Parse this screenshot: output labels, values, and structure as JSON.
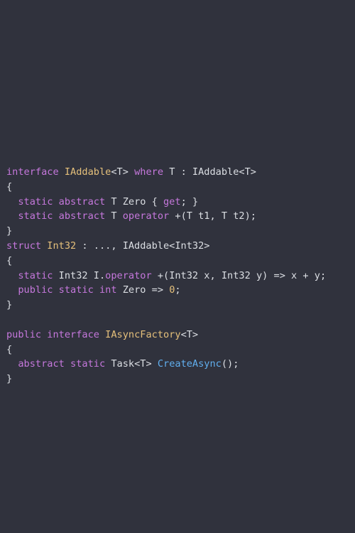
{
  "colors": {
    "background": "#30323d",
    "plain": "#dcdfe4",
    "keyword": "#c678dd",
    "type": "#e5c07b",
    "function": "#61afef",
    "number": "#e5c07b"
  },
  "code": [
    [
      {
        "t": "interface",
        "c": "kw"
      },
      {
        "t": " ",
        "c": "plain"
      },
      {
        "t": "IAddable",
        "c": "type"
      },
      {
        "t": "<T> ",
        "c": "plain"
      },
      {
        "t": "where",
        "c": "kw"
      },
      {
        "t": " T : IAddable<T>",
        "c": "plain"
      }
    ],
    [
      {
        "t": "{",
        "c": "plain"
      }
    ],
    [
      {
        "t": "  ",
        "c": "plain"
      },
      {
        "t": "static",
        "c": "kw"
      },
      {
        "t": " ",
        "c": "plain"
      },
      {
        "t": "abstract",
        "c": "kw"
      },
      {
        "t": " T Zero { ",
        "c": "plain"
      },
      {
        "t": "get",
        "c": "kw"
      },
      {
        "t": "; }",
        "c": "plain"
      }
    ],
    [
      {
        "t": "  ",
        "c": "plain"
      },
      {
        "t": "static",
        "c": "kw"
      },
      {
        "t": " ",
        "c": "plain"
      },
      {
        "t": "abstract",
        "c": "kw"
      },
      {
        "t": " T ",
        "c": "plain"
      },
      {
        "t": "operator",
        "c": "kw"
      },
      {
        "t": " +(T t1, T t2);",
        "c": "plain"
      }
    ],
    [
      {
        "t": "}",
        "c": "plain"
      }
    ],
    [
      {
        "t": "struct",
        "c": "kw"
      },
      {
        "t": " ",
        "c": "plain"
      },
      {
        "t": "Int32",
        "c": "type"
      },
      {
        "t": " : ..., IAddable<Int32>",
        "c": "plain"
      }
    ],
    [
      {
        "t": "{",
        "c": "plain"
      }
    ],
    [
      {
        "t": "  ",
        "c": "plain"
      },
      {
        "t": "static",
        "c": "kw"
      },
      {
        "t": " Int32 I.",
        "c": "plain"
      },
      {
        "t": "operator",
        "c": "kw"
      },
      {
        "t": " +(Int32 x, Int32 y) => x + y;",
        "c": "plain"
      }
    ],
    [
      {
        "t": "  ",
        "c": "plain"
      },
      {
        "t": "public",
        "c": "kw"
      },
      {
        "t": " ",
        "c": "plain"
      },
      {
        "t": "static",
        "c": "kw"
      },
      {
        "t": " ",
        "c": "plain"
      },
      {
        "t": "int",
        "c": "kw"
      },
      {
        "t": " Zero => ",
        "c": "plain"
      },
      {
        "t": "0",
        "c": "num"
      },
      {
        "t": ";",
        "c": "plain"
      }
    ],
    [
      {
        "t": "}",
        "c": "plain"
      }
    ],
    [],
    [
      {
        "t": "public",
        "c": "kw"
      },
      {
        "t": " ",
        "c": "plain"
      },
      {
        "t": "interface",
        "c": "kw"
      },
      {
        "t": " ",
        "c": "plain"
      },
      {
        "t": "IAsyncFactory",
        "c": "type"
      },
      {
        "t": "<T>",
        "c": "plain"
      }
    ],
    [
      {
        "t": "{",
        "c": "plain"
      }
    ],
    [
      {
        "t": "  ",
        "c": "plain"
      },
      {
        "t": "abstract",
        "c": "kw"
      },
      {
        "t": " ",
        "c": "plain"
      },
      {
        "t": "static",
        "c": "kw"
      },
      {
        "t": " Task<T> ",
        "c": "plain"
      },
      {
        "t": "CreateAsync",
        "c": "fn"
      },
      {
        "t": "();",
        "c": "plain"
      }
    ],
    [
      {
        "t": "}",
        "c": "plain"
      }
    ]
  ]
}
